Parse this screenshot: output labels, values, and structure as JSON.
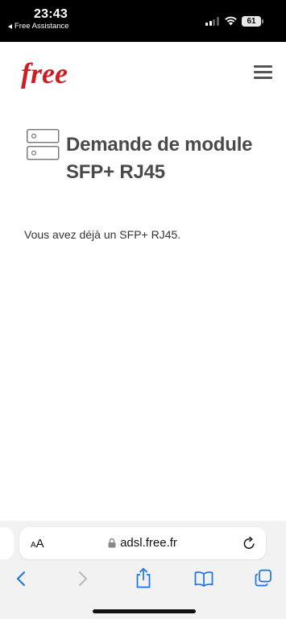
{
  "status_bar": {
    "time": "23:43",
    "back_app": "Free Assistance",
    "battery": "61"
  },
  "site": {
    "logo_text": "free",
    "brand_color": "#cd1e25"
  },
  "content": {
    "title": "Demande de module SFP+ RJ45",
    "message": "Vous avez déjà un SFP+ RJ45."
  },
  "browser": {
    "text_size_label": "AA",
    "url": "adsl.free.fr",
    "icons": [
      "lock-icon",
      "reload-icon",
      "back-icon",
      "forward-icon",
      "share-icon",
      "bookmarks-icon",
      "tabs-icon"
    ],
    "accent": "#1a73e8"
  }
}
